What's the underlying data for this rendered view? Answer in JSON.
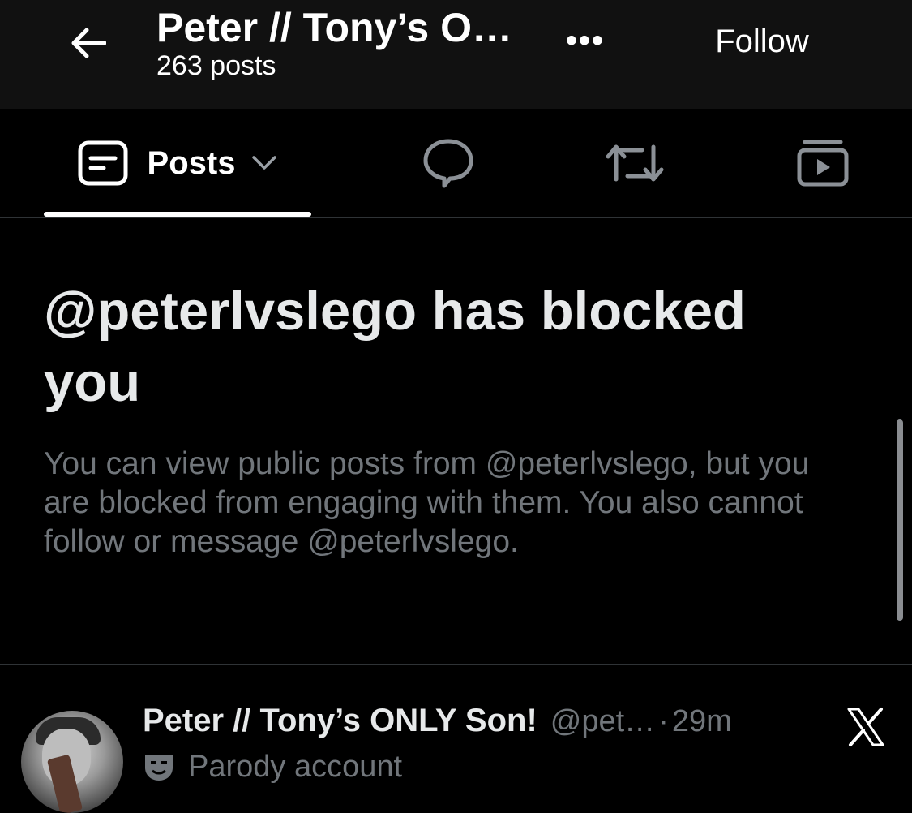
{
  "header": {
    "title": "Peter // Tony’s O…",
    "post_count": "263 posts",
    "more_label": "•••",
    "follow_label": "Follow"
  },
  "tabs": {
    "posts_label": "Posts",
    "active": "posts"
  },
  "blocked": {
    "title": "@peterlvslego has blocked you",
    "description": "You can view public posts from @peterlvslego, but you are blocked from engaging with them. You also cannot follow or message @peterlvslego."
  },
  "post": {
    "display_name": "Peter // Tony’s ONLY Son!",
    "handle": "@pet…",
    "separator": "·",
    "time": "29m",
    "label": "Parody account"
  },
  "colors": {
    "background": "#000000",
    "header_bg": "#111111",
    "primary_text": "#e7e9ea",
    "secondary_text": "#71767b"
  },
  "icons": [
    "back-arrow-icon",
    "more-icon",
    "posts-tab-icon",
    "chevron-down-icon",
    "reply-bubble-icon",
    "repost-icon",
    "media-icon",
    "x-logo-icon",
    "parody-mask-icon"
  ]
}
